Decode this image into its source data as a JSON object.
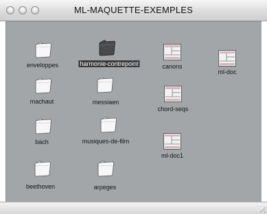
{
  "window": {
    "title": "ML-MAQUETTE-EXEMPLES"
  },
  "folders": [
    {
      "label": "enveloppes",
      "selected": false
    },
    {
      "label": "harmonie-contrepoint",
      "selected": true
    },
    {
      "label": "machaut",
      "selected": false
    },
    {
      "label": "messiaen",
      "selected": false
    },
    {
      "label": "bach",
      "selected": false
    },
    {
      "label": "musiques-de-film",
      "selected": false
    },
    {
      "label": "beethoven",
      "selected": false
    },
    {
      "label": "arpeges",
      "selected": false
    }
  ],
  "documents": [
    {
      "label": "canons"
    },
    {
      "label": "ml-doc"
    },
    {
      "label": "chord-seqs"
    },
    {
      "label": "ml-doc1"
    }
  ],
  "icons": {
    "folder": "folder-icon",
    "document": "maquette-document-icon"
  },
  "colors": {
    "background": "#a3a6a9",
    "selection": "#3a3a3a"
  }
}
